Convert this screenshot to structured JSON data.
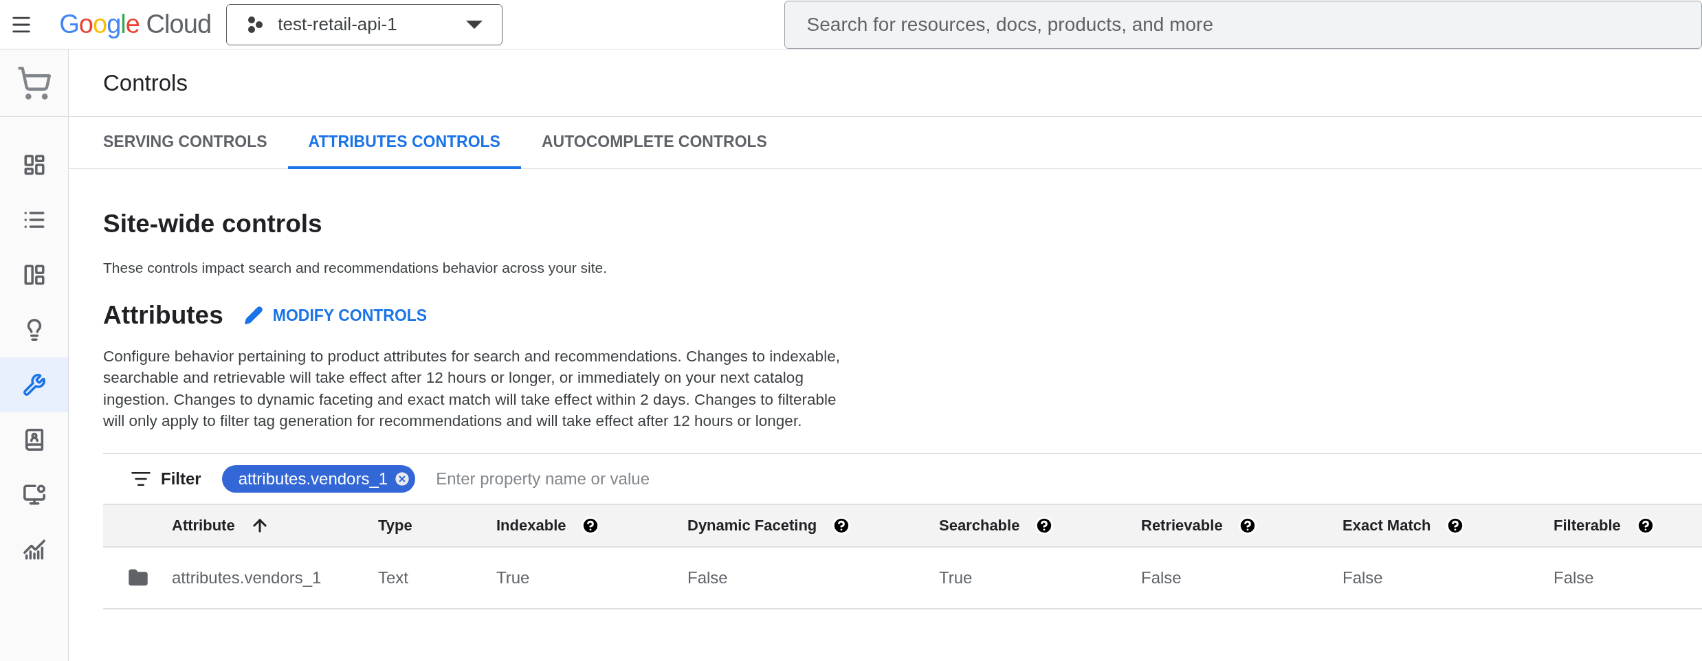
{
  "topbar": {
    "logo": "Google Cloud",
    "project": "test-retail-api-1",
    "search": {
      "placeholder": "Search for resources, docs, products, and more"
    }
  },
  "sidebar": {
    "items": [
      {
        "selected": false
      },
      {
        "selected": false
      },
      {
        "selected": false
      },
      {
        "selected": false
      },
      {
        "selected": true
      },
      {
        "selected": false
      },
      {
        "selected": false
      },
      {
        "selected": false
      }
    ]
  },
  "page": {
    "title": "Controls"
  },
  "tabs": [
    {
      "label": "SERVING CONTROLS",
      "selected": false
    },
    {
      "label": "ATTRIBUTES CONTROLS",
      "selected": true
    },
    {
      "label": "AUTOCOMPLETE CONTROLS",
      "selected": false
    }
  ],
  "site_wide": {
    "title": "Site-wide controls",
    "description": "These controls impact search and recommendations behavior across your site."
  },
  "attributes": {
    "title": "Attributes",
    "action": "MODIFY CONTROLS",
    "description": "Configure behavior pertaining to product attributes for search and recommendations. Changes to indexable, searchable and retrievable will take effect after 12 hours or longer, or immediately on your next catalog ingestion. Changes to dynamic faceting and exact match will take effect within 2 days. Changes to filterable will only apply to filter tag generation for recommendations and will take effect after 12 hours or longer."
  },
  "filter": {
    "label": "Filter",
    "chips": [
      "attributes.vendors_1"
    ],
    "placeholder": "Enter property name or value"
  },
  "table": {
    "columns": [
      {
        "label": "Attribute",
        "sorted": true,
        "help": false
      },
      {
        "label": "Type",
        "sorted": false,
        "help": false
      },
      {
        "label": "Indexable",
        "sorted": false,
        "help": true
      },
      {
        "label": "Dynamic Faceting",
        "sorted": false,
        "help": true
      },
      {
        "label": "Searchable",
        "sorted": false,
        "help": true
      },
      {
        "label": "Retrievable",
        "sorted": false,
        "help": true
      },
      {
        "label": "Exact Match",
        "sorted": false,
        "help": true
      },
      {
        "label": "Filterable",
        "sorted": false,
        "help": true
      }
    ],
    "rows": [
      {
        "cells": [
          "attributes.vendors_1",
          "Text",
          "True",
          "False",
          "True",
          "False",
          "False",
          "False"
        ]
      }
    ]
  }
}
